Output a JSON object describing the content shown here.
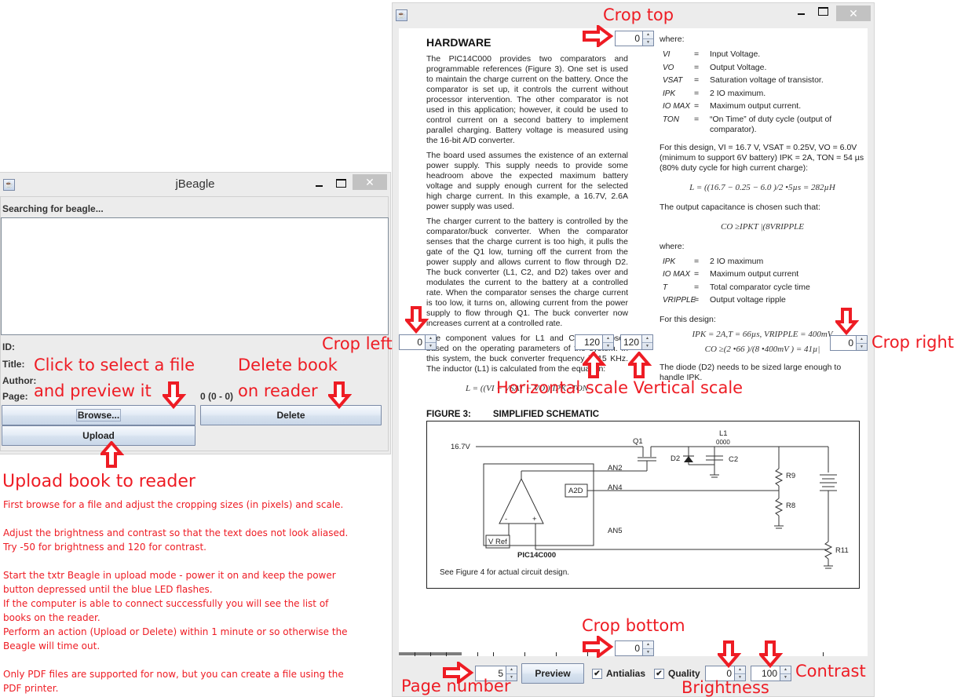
{
  "jbeagle": {
    "title": "jBeagle",
    "status": "Searching for beagle...",
    "labels": {
      "id": "ID:",
      "title": "Title:",
      "author": "Author:",
      "page": "Page:"
    },
    "page_info": "0 (0 - 0)",
    "browse_label": "Browse...",
    "delete_label": "Delete",
    "upload_label": "Upload",
    "close_glyph": "✕"
  },
  "preview": {
    "close_glyph": "✕",
    "crop_top": "0",
    "crop_left": "0",
    "crop_right": "0",
    "crop_bottom": "0",
    "horizontal_scale": "120",
    "vertical_scale": "120",
    "page_number": "5",
    "preview_label": "Preview",
    "antialias_label": "Antialias",
    "antialias_checked": true,
    "quality_label": "Quality",
    "quality_checked": true,
    "brightness": "0",
    "contrast": "100",
    "check_glyph": "✔",
    "spin_up": "▲",
    "spin_down": "▼"
  },
  "document": {
    "heading": "HARDWARE",
    "left_paragraphs": [
      "The PIC14C000 provides two comparators and programmable references (Figure 3). One set is used to maintain the charge current on the battery. Once the comparator is set up, it controls the current without processor intervention.   The other comparator is not used in this application; however, it could be used to control current on a second battery to implement parallel charging. Battery voltage is measured using the 16-bit A/D converter.",
      "The board used assumes the existence of an external power supply. This supply needs to provide some headroom above the expected maximum battery voltage and supply enough current for the selected high charge current. In this example, a 16.7V, 2.6A power supply was used.",
      "The charger current to the battery is controlled by the comparator/buck converter. When the comparator senses that the charge current is too high, it pulls the gate of the Q1 low, turning off the current from the power supply and allows current to flow through D2. The buck converter (L1, C2, and D2) takes over and modulates the current to the battery at a controlled rate. When the comparator senses the charge current is too low, it turns on, allowing current from the power supply to flow through Q1. The buck converter now increases current at a controlled rate.",
      "The component values for L1 and C2 are chosen based on the operating parameters of the system. In this system, the buck converter frequency is 15 KHz. The inductor (L1) is calculated from the equation:"
    ],
    "left_equation": "L = ((VI − VSAT − VO )|IPK •TON",
    "where_1": "where:",
    "defs_1": [
      {
        "sym": "VI",
        "desc": "Input Voltage."
      },
      {
        "sym": "VO",
        "desc": "Output Voltage."
      },
      {
        "sym": "VSAT",
        "desc": "Saturation voltage of transistor."
      },
      {
        "sym": "IPK",
        "desc": "2 IO maximum."
      },
      {
        "sym": "IO MAX",
        "desc": "Maximum output current."
      },
      {
        "sym": "TON",
        "desc": "“On Time” of duty cycle (output of comparator)."
      }
    ],
    "design_para": "For this design, VI = 16.7 V, VSAT = 0.25V, VO = 6.0V (minimum to support 6V battery) IPK = 2A, TON = 54 µs (80% duty cycle for high current charge):",
    "equation_l": "L = ((16.7 − 0.25 − 6.0 )/2 •5µs = 282µH",
    "output_cap_para": "The output capacitance is chosen such that:",
    "equation_co": "CO ≥IPKT |(8VRIPPLE",
    "where_2": "where:",
    "defs_2": [
      {
        "sym": "IPK",
        "desc": "2 IO maximum"
      },
      {
        "sym": "IO MAX",
        "desc": "Maximum output current"
      },
      {
        "sym": "T",
        "desc": "Total comparator cycle time"
      },
      {
        "sym": "VRIPPLE",
        "desc": "Output voltage ripple"
      }
    ],
    "for_design": "For this design:",
    "equation_ipk": "IPK = 2A,T = 66µs, VRIPPLE = 400mV",
    "equation_co2": "CO ≥(2 •66 )/(8 •400mV ) = 41µ|",
    "diode_para": "The diode (D2) needs to be sized large enough to handle IPK.",
    "figure_label": "FIGURE 3:",
    "figure_title": "SIMPLIFIED SCHEMATIC",
    "schematic": {
      "v_in": "16.7V",
      "q1": "Q1",
      "l1": "L1",
      "l1_coil": "0000",
      "d2": "D2",
      "c2": "C2",
      "r9": "R9",
      "r8": "R8",
      "r11": "R11",
      "an2": "AN2",
      "an4": "AN4",
      "an5": "AN5",
      "a2d": "A2D",
      "vref": "V Ref",
      "minus": "-",
      "plus": "+",
      "chip": "PIC14C000",
      "note": "See Figure 4 for actual circuit design."
    }
  },
  "annotations": {
    "crop_top": "Crop top",
    "crop_left": "Crop left",
    "crop_right": "Crop right",
    "crop_bottom": "Crop bottom",
    "horizontal_vertical_scale": "Horizontal scale Vertical scale",
    "page_number": "Page number",
    "brightness": "Brightness",
    "contrast": "Contrast",
    "browse_hint_1": "Click to select a file",
    "browse_hint_2": "and preview it",
    "delete_hint_1": "Delete book",
    "delete_hint_2": "on reader",
    "upload_hint": "Upload book to reader",
    "instructions": [
      "First browse for a file and adjust the cropping sizes (in pixels) and scale.",
      "",
      "Adjust the brightness and contrast so that the text does not look aliased.",
      "Try -50 for brightness and 120 for contrast.",
      "",
      "Start the txtr Beagle in upload mode - power it on and keep the power button depressed until the blue LED flashes.",
      "If the computer is able to connect successfully you will see the list of books on the reader.",
      "Perform an action (Upload or Delete) within 1 minute or so otherwise the Beagle will time out.",
      "",
      "Only PDF files are supported for now, but you can create a file using the PDF printer."
    ],
    "color": "#ee1c24"
  }
}
